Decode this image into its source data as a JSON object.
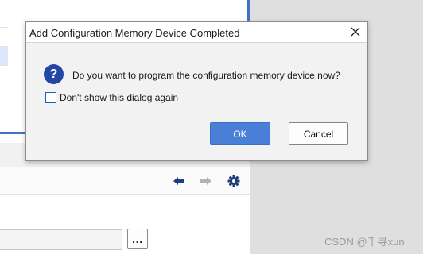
{
  "dialog": {
    "title": "Add Configuration Memory Device Completed",
    "question": "Do you want to program the configuration memory device now?",
    "checkbox_underlined": "D",
    "checkbox_rest": "on't show this dialog again",
    "checkbox_checked": false,
    "ok_label": "OK",
    "cancel_label": "Cancel",
    "icons": {
      "question": "question-icon",
      "close": "close-icon"
    }
  },
  "background": {
    "toolbar_icons": [
      "arrow-left-icon",
      "arrow-right-icon",
      "gear-icon"
    ],
    "ellipsis_label": "..."
  },
  "watermark": "CSDN @千寻xun",
  "colors": {
    "accent": "#4a7fd8",
    "question_icon": "#2346a6",
    "panel_border": "#3f72c8"
  }
}
